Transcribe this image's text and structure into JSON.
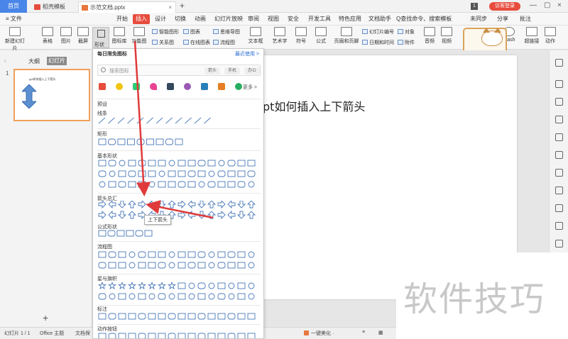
{
  "titlebar": {
    "home_label": "首页",
    "tabs": [
      {
        "label": "稻壳模板",
        "color": "#e74c3c",
        "active": false
      },
      {
        "label": "示范文档.pptx",
        "color": "#e8763d",
        "active": true
      }
    ],
    "page_count": "1",
    "login_label": "访客登录"
  },
  "menubar": {
    "file_label": "≡ 文件",
    "items": [
      "开始",
      "插入",
      "设计",
      "切换",
      "动画",
      "幻灯片放映",
      "审阅",
      "视图",
      "安全",
      "开发工具",
      "特色应用",
      "文档助手"
    ],
    "active": "插入",
    "search_label": "Q查找命令、搜索模板",
    "sync_label": "未同步",
    "share_label": "分享",
    "comment_label": "批注"
  },
  "ribbon": {
    "new_slide": "新建幻灯片",
    "table": "表格",
    "image": "图片",
    "screenshot": "截屏",
    "shapes": "形状",
    "icon_lib": "图标库",
    "func_chart": "功能图",
    "smart_shape": "智能图形",
    "chart": "图表",
    "mindmap": "思维导图",
    "relation": "关系图",
    "online_chart": "在线图表",
    "flowchart": "流程图",
    "textbox": "文本框",
    "wordart": "艺术字",
    "symbol": "符号",
    "formula": "公式",
    "header_footer": "页眉和页脚",
    "slide_number": "幻灯片编号",
    "object": "对象",
    "date_time": "日期和时间",
    "attachment": "附件",
    "audio": "音频",
    "video": "视频",
    "flash": "Flash",
    "hyperlink": "超链接",
    "action": "动作"
  },
  "mascot": {
    "text": "CN"
  },
  "leftpanel": {
    "outline_tab": "大纲",
    "slides_tab": "幻灯片",
    "slide_number": "1",
    "thumb_title": "ppt如何插入上下箭头"
  },
  "slide": {
    "title_text": "pt如何插入上下箭头"
  },
  "shapes_panel": {
    "title": "每日限免图标",
    "recent": "最近使用 >",
    "search_placeholder": "搜索图标",
    "chips": [
      "箭头",
      "手机",
      "办公"
    ],
    "more": "更多 >",
    "sections": [
      "预设",
      "线条",
      "矩形",
      "基本形状",
      "箭头总汇",
      "公式形状",
      "流程图",
      "星与旗帜",
      "标注",
      "动作按钮"
    ],
    "tooltip": "上下箭头",
    "icon_colors": [
      "#e74c3c",
      "#f1c40f",
      "#2ecc71",
      "#e84393",
      "#34495e",
      "#9b59b6",
      "#2980b9",
      "#e67e22",
      "#27ae60"
    ]
  },
  "statusbar": {
    "slide_info": "幻灯片 1 / 1",
    "theme": "Office 主题",
    "doc_protect": "文档保",
    "beautify": "一键美化 ·"
  },
  "watermark": {
    "text": "软件技巧"
  },
  "colors": {
    "accent": "#e74c3c",
    "annotation_arrow": "#e03a3a",
    "shape_stroke": "#4a78b8"
  }
}
